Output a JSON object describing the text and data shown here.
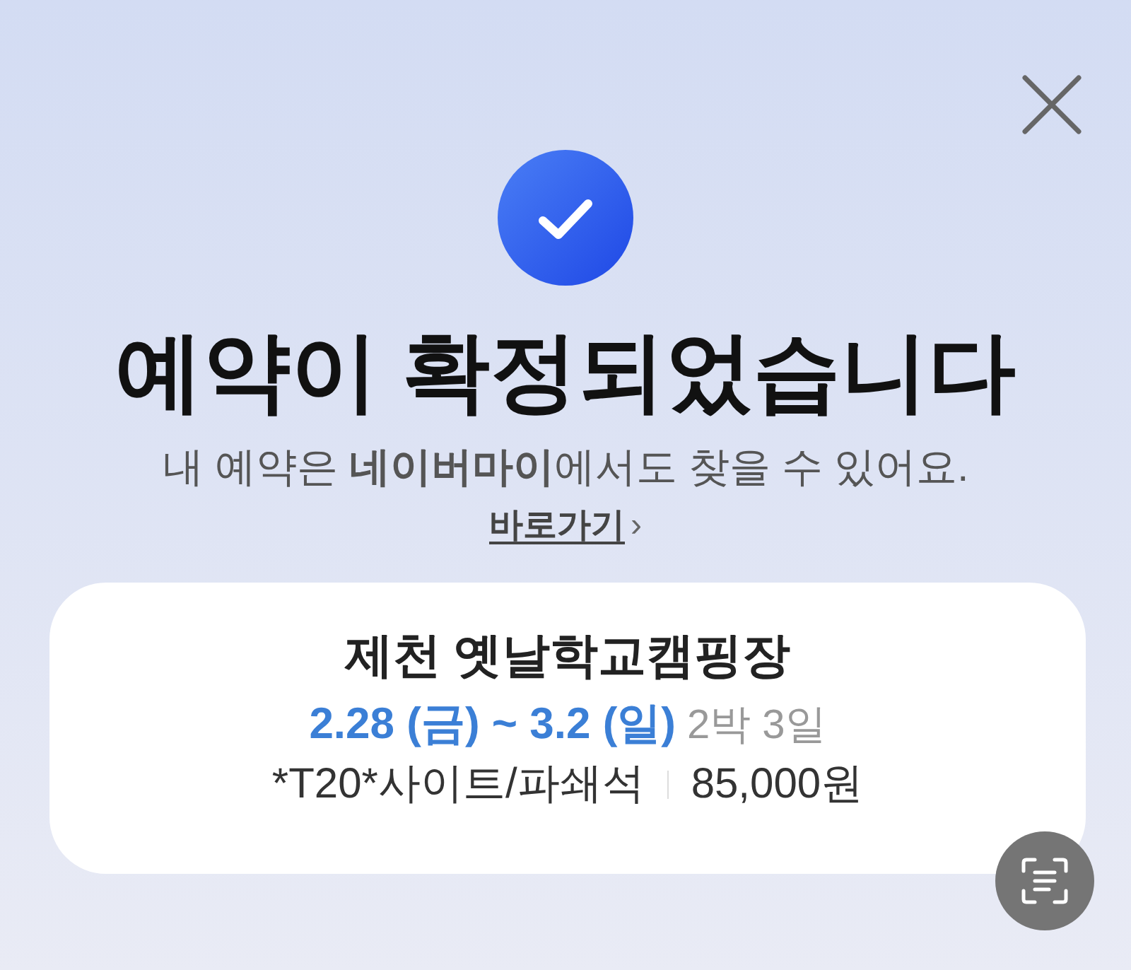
{
  "title": "예약이 확정되었습니다",
  "subtitle": "내 예약은 **네이버마이**에서도 찾을 수 있어요.",
  "link": {
    "label": "바로가기",
    "chevron": "›"
  },
  "booking": {
    "place": "제천 옛날학교캠핑장",
    "dates": "2.28 (금) ~ 3.2 (일)",
    "duration": "2박 3일",
    "site": "*T20*사이트/파쇄석",
    "price": "85,000원"
  }
}
